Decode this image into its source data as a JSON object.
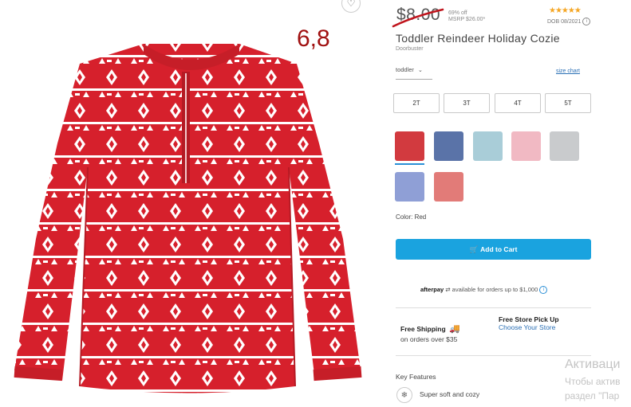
{
  "image": {
    "alt": "Toddler Reindeer Holiday Cozie",
    "annotation": "6,8"
  },
  "price": {
    "current": "$8.00",
    "off": "69% off",
    "msrp": "MSRP $26.00*"
  },
  "rating": {
    "stars": "★★★★★",
    "dob": "DOB 08/2021"
  },
  "product": {
    "title": "Toddler Reindeer Holiday Cozie",
    "badge": "Doorbuster"
  },
  "size": {
    "selector_value": "toddler",
    "chart_link": "size chart",
    "options": [
      "2T",
      "3T",
      "4T",
      "5T"
    ]
  },
  "swatches": [
    {
      "name": "red",
      "color": "#d23a3f"
    },
    {
      "name": "blue",
      "color": "#5a73a8"
    },
    {
      "name": "light-blue",
      "color": "#a9cdd8"
    },
    {
      "name": "pink-stripe",
      "color": "#f1b9c3"
    },
    {
      "name": "gray",
      "color": "#c9cbcd"
    },
    {
      "name": "lavender",
      "color": "#8f9fd6"
    },
    {
      "name": "coral",
      "color": "#e27b78"
    }
  ],
  "color_label": "Color: Red",
  "cart_button": "Add to Cart",
  "afterpay": {
    "brand": "afterpay",
    "text": "available for orders up to $1,000"
  },
  "shipping": {
    "title": "Free Shipping",
    "subtitle": "on orders over $35",
    "pickup_title": "Free Store Pick Up",
    "pickup_link": "Choose Your Store"
  },
  "features": {
    "heading": "Key Features",
    "items": [
      "Super soft and cozy"
    ]
  },
  "windows_watermark": {
    "line1": "Активаци",
    "line2": "Чтобы актив",
    "line3": "раздел \"Пар"
  }
}
